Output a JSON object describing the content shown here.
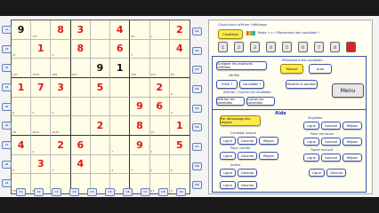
{
  "grid": [
    [
      {
        "v": "9",
        "c": "black"
      },
      {
        "v": "",
        "n": "147"
      },
      {
        "v": "8",
        "c": "red"
      },
      {
        "v": "3",
        "c": "red"
      },
      {
        "v": "",
        "n": ""
      },
      {
        "v": "4",
        "c": "red"
      },
      {
        "v": "",
        "n": "56"
      },
      {
        "v": "",
        "n": "7"
      },
      {
        "v": "2",
        "c": "red"
      }
    ],
    [
      {
        "v": "",
        "n": "37"
      },
      {
        "v": "1",
        "c": "red"
      },
      {
        "v": "",
        "n": "3"
      },
      {
        "v": "8",
        "c": "red"
      },
      {
        "v": "",
        "n": ""
      },
      {
        "v": "6",
        "c": "red"
      },
      {
        "v": "",
        "n": "7"
      },
      {
        "v": "",
        "n": ""
      },
      {
        "v": "4",
        "c": "red"
      }
    ],
    [
      {
        "v": "",
        "n": "237"
      },
      {
        "v": "",
        "n": "3478"
      },
      {
        "v": "",
        "n": "456"
      },
      {
        "v": "",
        "n": "127"
      },
      {
        "v": "9",
        "c": "black"
      },
      {
        "v": "1",
        "c": "black"
      },
      {
        "v": "",
        "n": "156"
      },
      {
        "v": "",
        "n": "357"
      },
      {
        "v": "",
        "n": "36"
      }
    ],
    [
      {
        "v": "1",
        "c": "red"
      },
      {
        "v": "7",
        "c": "red"
      },
      {
        "v": "3",
        "c": "red"
      },
      {
        "v": "",
        "n": ""
      },
      {
        "v": "5",
        "c": "red"
      },
      {
        "v": "",
        "n": ""
      },
      {
        "v": "",
        "n": ""
      },
      {
        "v": "2",
        "c": "red"
      },
      {
        "v": "",
        "n": "8"
      }
    ],
    [
      {
        "v": "",
        "n": "8"
      },
      {
        "v": "",
        "n": "5"
      },
      {
        "v": "",
        "n": "4"
      },
      {
        "v": "",
        "n": ""
      },
      {
        "v": "",
        "n": ""
      },
      {
        "v": "",
        "n": ""
      },
      {
        "v": "9",
        "c": "red"
      },
      {
        "v": "6",
        "c": "red"
      },
      {
        "v": "",
        "n": "3"
      }
    ],
    [
      {
        "v": "",
        "n": "48"
      },
      {
        "v": "",
        "n": "4599"
      },
      {
        "v": "",
        "n": "4678"
      },
      {
        "v": "",
        "n": ""
      },
      {
        "v": "2",
        "c": "red"
      },
      {
        "v": "",
        "n": ""
      },
      {
        "v": "8",
        "c": "red"
      },
      {
        "v": "",
        "n": "35"
      },
      {
        "v": "1",
        "c": "red"
      }
    ],
    [
      {
        "v": "4",
        "c": "red"
      },
      {
        "v": "",
        "n": "2"
      },
      {
        "v": "2",
        "c": "red"
      },
      {
        "v": "6",
        "c": "red"
      },
      {
        "v": "",
        "n": ""
      },
      {
        "v": "",
        "n": "7"
      },
      {
        "v": "9",
        "c": "red"
      },
      {
        "v": "",
        "n": "3"
      },
      {
        "v": "5",
        "c": "red"
      }
    ],
    [
      {
        "v": "",
        "n": "5"
      },
      {
        "v": "3",
        "c": "red"
      },
      {
        "v": "",
        "n": "3"
      },
      {
        "v": "4",
        "c": "red"
      },
      {
        "v": "",
        "n": ""
      },
      {
        "v": "",
        "n": "4"
      },
      {
        "v": "",
        "n": "7"
      },
      {
        "v": "",
        "n": "4"
      },
      {
        "v": "",
        "n": "8"
      }
    ],
    [
      {
        "v": "",
        "n": "78"
      },
      {
        "v": "",
        "n": "5009"
      },
      {
        "v": "",
        "n": "47"
      },
      {
        "v": "",
        "n": "17"
      },
      {
        "v": "",
        "n": "4"
      },
      {
        "v": "",
        "n": "187"
      },
      {
        "v": "",
        "n": "4"
      },
      {
        "v": "",
        "n": "23"
      },
      {
        "v": "",
        "n": "8"
      }
    ]
  ],
  "row_tags": [
    "L1",
    "L2",
    "L3",
    "L4",
    "L5",
    "L6",
    "L7",
    "L8",
    "L9"
  ],
  "col_tags": [
    "C1",
    "C2",
    "C3",
    "C4",
    "C5",
    "C5",
    "C6",
    "C7",
    "C8",
    "C9"
  ],
  "region_tags": [
    "R1",
    "R2",
    "R3",
    "R4",
    "R5",
    "R6",
    "R7",
    "R8",
    "R9"
  ],
  "right": {
    "header_text": "Choisir pour afficher l'affichage",
    "candidats_label": "Candidats",
    "mode_text": "Mode === Effacement des candidats !!",
    "numbers": [
      "1",
      "2",
      "3",
      "4",
      "5",
      "6",
      "7",
      "8",
      "9"
    ],
    "section1_label": "Surligner les instances chiffrées",
    "effacement_label": "Effacement des candidats",
    "manuel_label": "Manuel",
    "auto_label": "Auto",
    "verifier_label": "Vérifier",
    "grille_label": "Grille ?",
    "candidats_q_label": "Candidats ?",
    "montrer_label": "Montrer la solution",
    "menu_label": "Menu",
    "afficher_section_label": "Afficher / Cacher les candidats",
    "afficher_label": "Afficher les candidats",
    "cacher_label": "Cacher les candidats",
    "aide_title": "Aide",
    "par_decoupage_label": "Par découpage des régions",
    "ligne": "Ligne",
    "colonne": "Colonne",
    "region": "Région",
    "singleton_label": "Singleton",
    "candidat_unique_label": "Candidat unique",
    "paire_label": "Paire exclusive",
    "triplet_label": "Triplet exclusif",
    "paire_cachee_label": "Paire cachée",
    "autres_label": "Autres"
  }
}
